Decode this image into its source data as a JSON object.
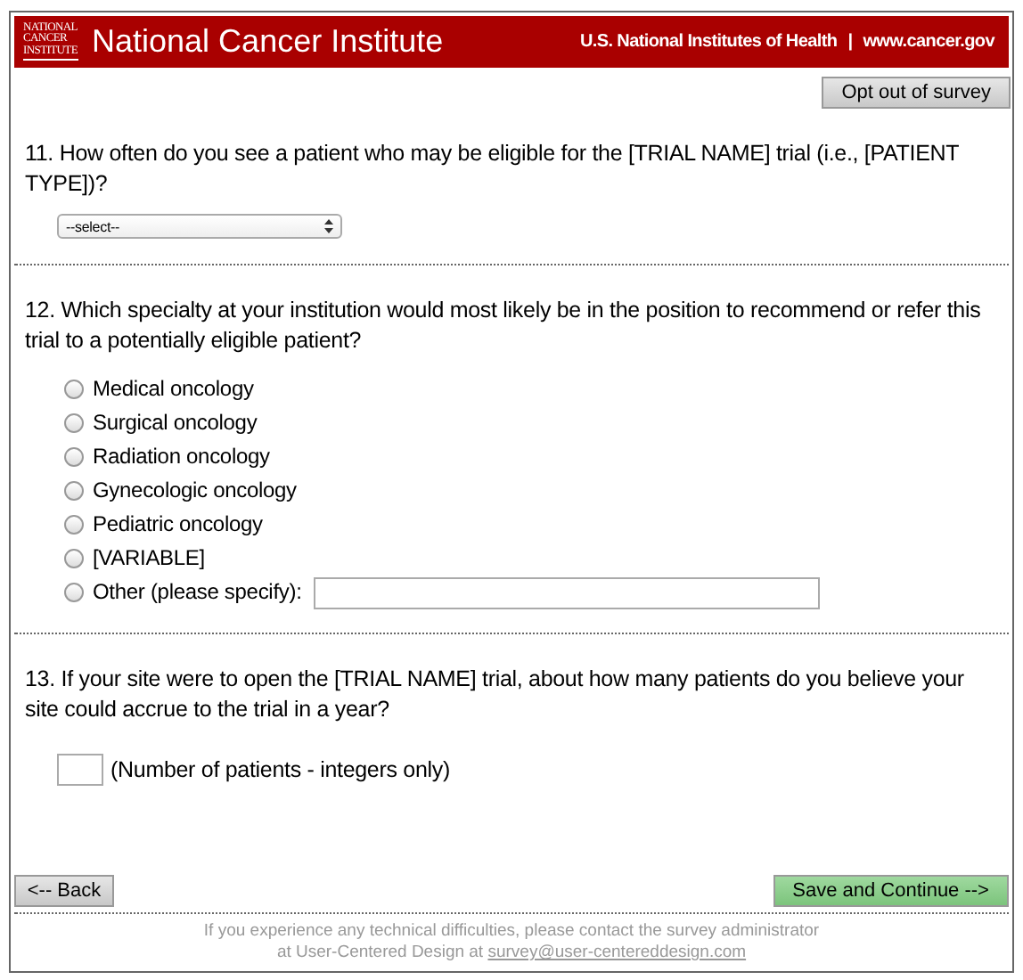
{
  "header": {
    "logo_lines": [
      "NATIONAL",
      "CANCER",
      "INSTITUTE"
    ],
    "title": "National Cancer Institute",
    "links": [
      "U.S. National Institutes of Health",
      "|",
      "www.cancer.gov"
    ]
  },
  "opt_out_button": "Opt out of survey",
  "questions": [
    {
      "kind": "select",
      "text": "11. How often do you see a patient who may be eligible for the [TRIAL NAME] trial (i.e., [PATIENT TYPE])?",
      "value": "--select--"
    },
    {
      "kind": "radio",
      "text": "12. Which specialty at your institution would most likely be in the position to recommend or refer this trial to a potentially eligible patient?",
      "options": [
        {
          "label": "Medical oncology",
          "selected": false
        },
        {
          "label": "Surgical oncology",
          "selected": false
        },
        {
          "label": "Radiation oncology",
          "selected": false
        },
        {
          "label": "Gynecologic oncology",
          "selected": false
        },
        {
          "label": "Pediatric oncology",
          "selected": false
        },
        {
          "label": "[VARIABLE]",
          "selected": false
        },
        {
          "label": "Other (please specify):",
          "selected": false,
          "kind": "other"
        }
      ]
    },
    {
      "kind": "number",
      "text": "13. If your site were to open the [TRIAL NAME] trial, about how many patients do you believe your site could accrue to the trial in a year?",
      "hint": "(Number of patients - integers only)"
    }
  ],
  "back_button": "<-- Back",
  "continue_button": "Save and Continue -->",
  "footer": {
    "line1": "If you experience any technical difficulties, please contact the survey administrator",
    "line2": "at User-Centered Design at",
    "email": "survey@user-centereddesign.com"
  }
}
